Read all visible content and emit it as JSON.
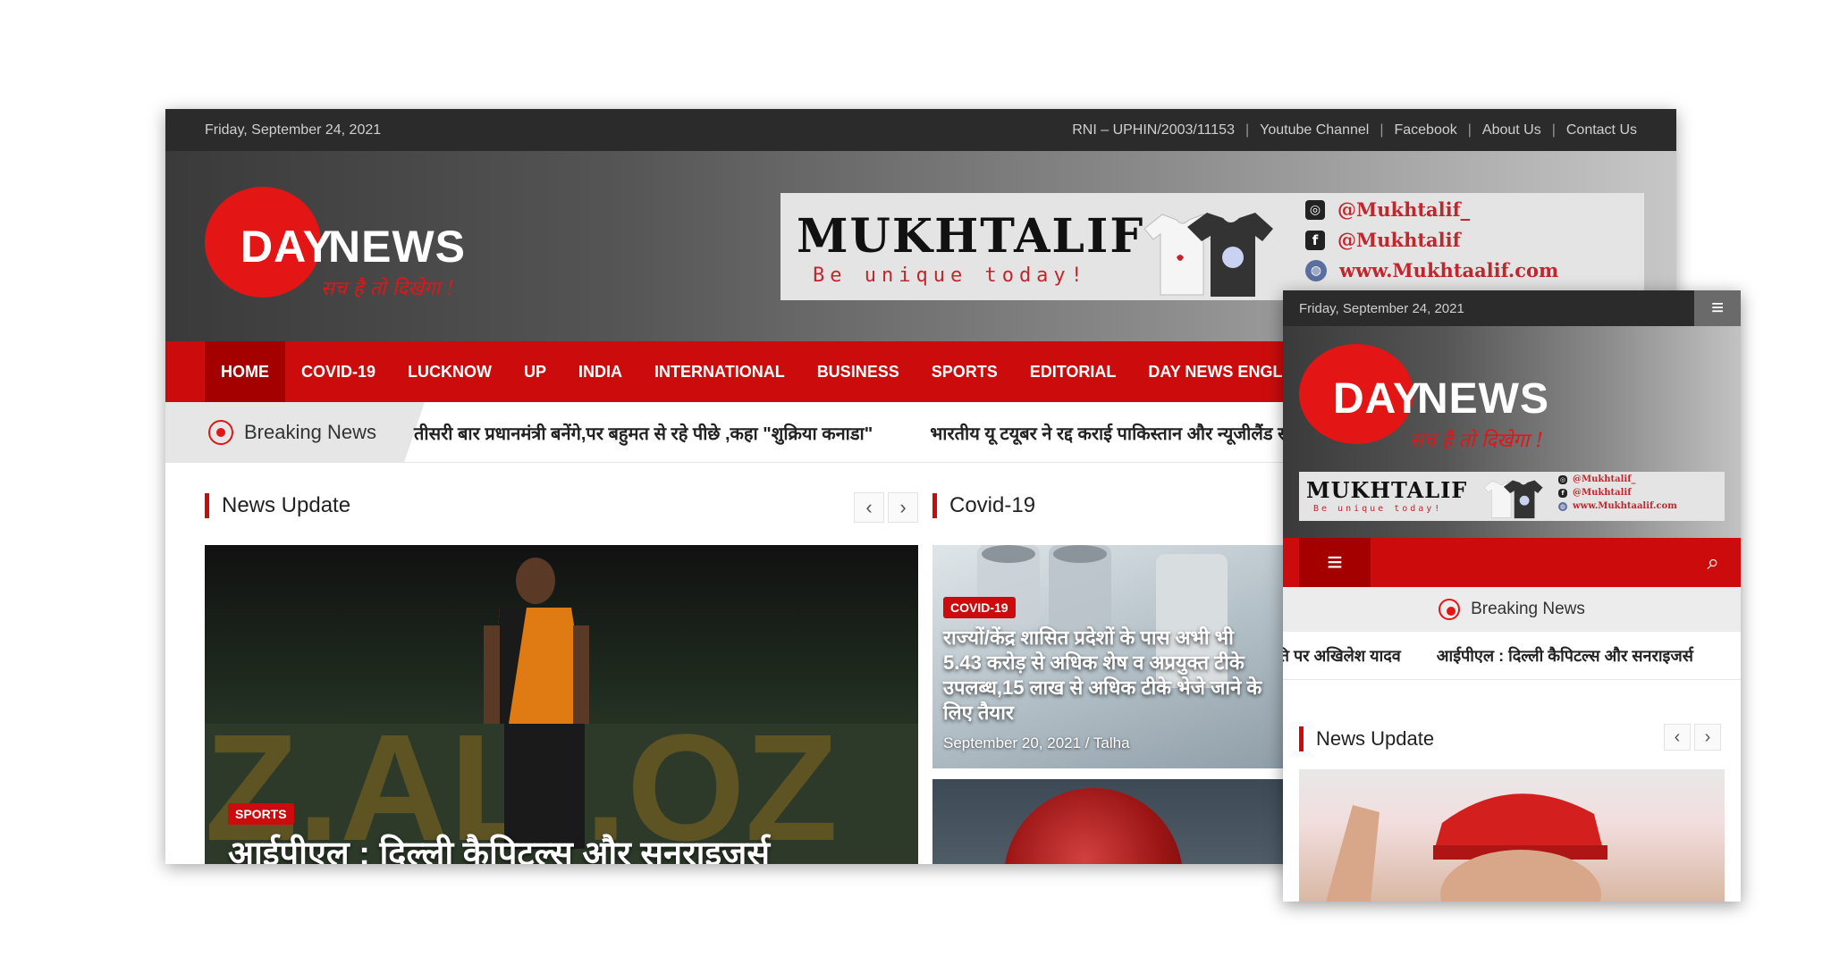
{
  "desktop": {
    "topbar": {
      "date": "Friday, September 24, 2021",
      "rni": "RNI – UPHIN/2003/11153",
      "links": [
        "Youtube Channel",
        "Facebook",
        "About Us",
        "Contact Us"
      ],
      "separator": "|"
    },
    "logo": {
      "word1": "DAY",
      "word2": "NEWS",
      "tagline": "सच है तो दिखेगा !"
    },
    "ad": {
      "brand": "MUKHTALIF",
      "slogan": "Be unique today!",
      "instagram": "@Mukhtalif_",
      "facebook": "@Mukhtalif",
      "website": "www.Mukhtaalif.com",
      "icons": [
        "instagram-icon",
        "facebook-icon",
        "globe-icon"
      ]
    },
    "nav": [
      "HOME",
      "COVID-19",
      "LUCKNOW",
      "UP",
      "INDIA",
      "INTERNATIONAL",
      "BUSINESS",
      "SPORTS",
      "EDITORIAL",
      "DAY NEWS ENGLISH"
    ],
    "breaking": {
      "label": "Breaking News",
      "items": [
        "तीसरी बार प्रधानमंत्री बनेंगे,पर बहुमत से रहे पीछे ,कहा \"शुक्रिया कनाडा\"",
        "भारतीय यू टयूबर ने रद्द कराई पाकिस्तान और न्यूजीलैंड सीरीज"
      ]
    },
    "news_update": {
      "title": "News Update",
      "prev": "‹",
      "next": "›",
      "hero": {
        "category": "SPORTS",
        "headline": "आईपीएल : दिल्ली कैपिटल्स और सनराइजर्स"
      }
    },
    "covid": {
      "title": "Covid-19",
      "card": {
        "category": "COVID-19",
        "headline": "राज्यों/केंद्र शासित प्रदेशों के पास अभी भी 5.43 करोड़ से अधिक शेष व अप्रयुक्त टीके उपलब्ध,15 लाख से अधिक टीके भेजे जाने के लिए तैयार",
        "meta": "September 20, 2021 / Talha"
      }
    }
  },
  "mobile": {
    "topbar": {
      "date": "Friday, September 24, 2021",
      "menu_icon": "≡"
    },
    "logo": {
      "word1": "DAY",
      "word2": "NEWS",
      "tagline": "सच है तो दिखेगा !"
    },
    "ad": {
      "brand": "MUKHTALIF",
      "slogan": "Be unique today!",
      "instagram": "@Mukhtalif_",
      "facebook": "@Mukhtalif",
      "website": "www.Mukhtaalif.com"
    },
    "nav": {
      "menu_icon": "≡",
      "search_icon": "⌕"
    },
    "breaking": {
      "label": "Breaking News",
      "items": [
        "राजनीति पर अखिलेश यादव",
        "आईपीएल : दिल्ली कैपिटल्स और सनराइजर्स"
      ]
    },
    "news_update": {
      "title": "News Update",
      "prev": "‹",
      "next": "›"
    }
  },
  "colors": {
    "brand_red": "#cc0c0c",
    "dark_bar": "#2b2b2b",
    "logo_red": "#e41515"
  }
}
